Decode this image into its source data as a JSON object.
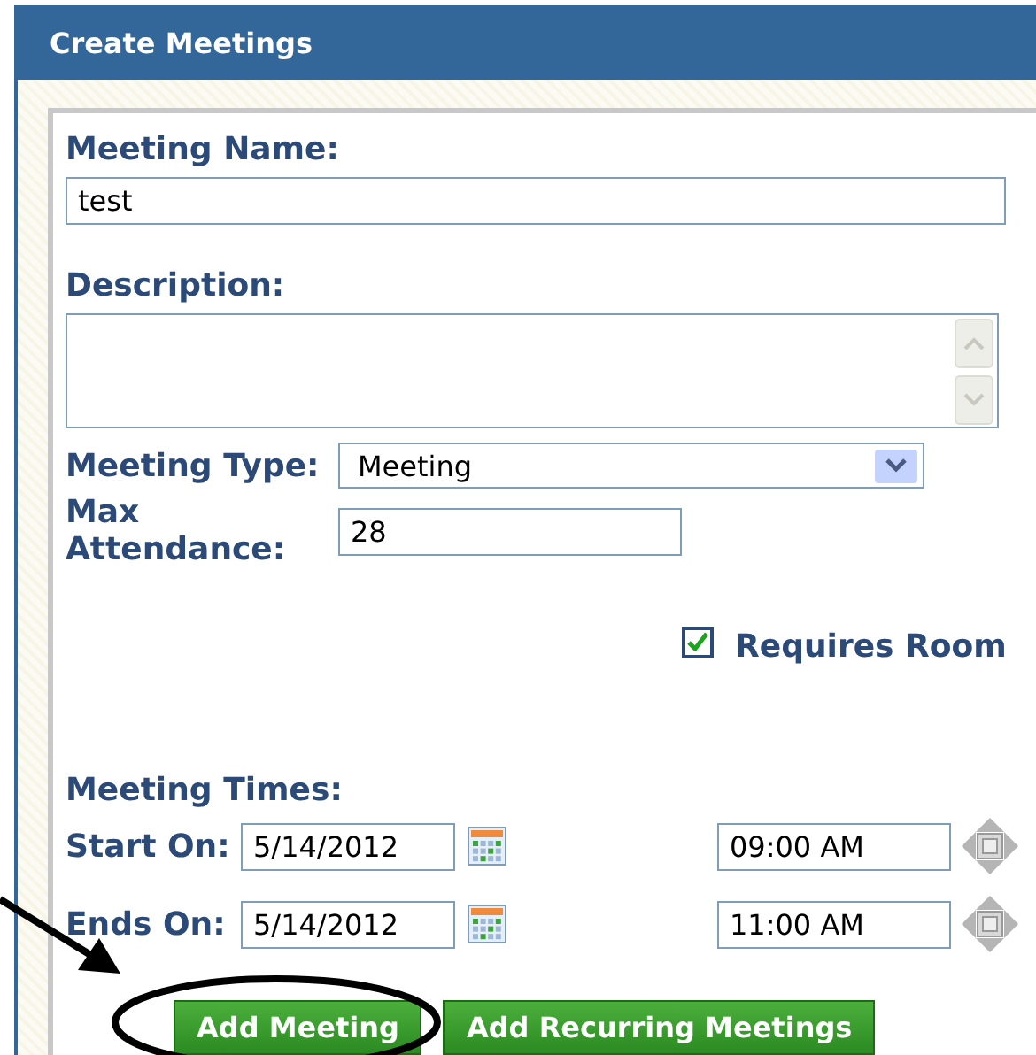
{
  "panel": {
    "title": "Create Meetings"
  },
  "name_field": {
    "label": "Meeting Name:",
    "value": "test"
  },
  "description_field": {
    "label": "Description:"
  },
  "meeting_type": {
    "label": "Meeting Type:",
    "value": "Meeting"
  },
  "max_attendance": {
    "label": "Max Attendance:",
    "value": "28"
  },
  "requires_room": {
    "label": "Requires Room",
    "checked": true
  },
  "meeting_times": {
    "label": "Meeting Times:",
    "rows": [
      {
        "label": "Start On:",
        "date": "5/14/2012",
        "time": "09:00 AM"
      },
      {
        "label": "Ends On:",
        "date": "5/14/2012",
        "time": "11:00 AM"
      }
    ]
  },
  "buttons": [
    {
      "label": "Add Meeting",
      "highlighted": true
    },
    {
      "label": "Add Recurring Meetings",
      "highlighted": false
    }
  ]
}
